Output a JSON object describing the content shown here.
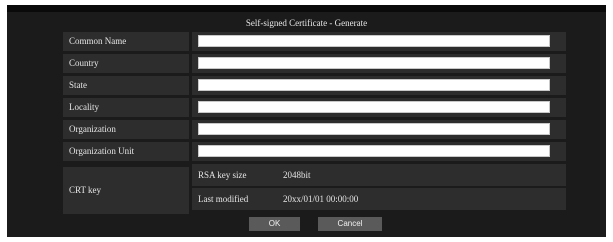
{
  "dialog": {
    "title": "Self-signed Certificate - Generate"
  },
  "fields": [
    {
      "label": "Common Name",
      "value": ""
    },
    {
      "label": "Country",
      "value": ""
    },
    {
      "label": "State",
      "value": ""
    },
    {
      "label": "Locality",
      "value": ""
    },
    {
      "label": "Organization",
      "value": ""
    },
    {
      "label": "Organization Unit",
      "value": ""
    }
  ],
  "crt": {
    "label": "CRT key",
    "rsa_key_size_label": "RSA key size",
    "rsa_key_size_value": "2048bit",
    "last_modified_label": "Last modified",
    "last_modified_value": "20xx/01/01 00:00:00"
  },
  "buttons": {
    "ok_label": "OK",
    "cancel_label": "Cancel"
  },
  "colors": {
    "panel_bg": "#1b1b1b",
    "row_bg": "#2d2d2d",
    "button_bg": "#5a5a5a",
    "text": "#e6e6e6"
  }
}
